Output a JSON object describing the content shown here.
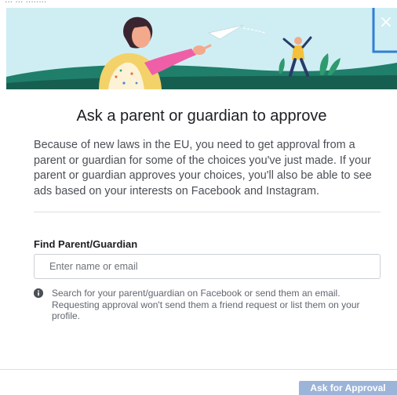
{
  "header": {
    "cut_off_text": "... ... ........"
  },
  "dialog": {
    "title": "Ask a parent or guardian to approve",
    "description": "Because of new laws in the EU, you need to get approval from a parent or guardian for some of the choices you've just made. If your parent or guardian approves your choices, you'll also be able to see ads based on your interests on Facebook and Instagram.",
    "field_label": "Find Parent/Guardian",
    "search": {
      "placeholder": "Enter name or email",
      "value": ""
    },
    "hint": "Search for your parent/guardian on Facebook or send them an email. Requesting approval won't send them a friend request or list them on your profile.",
    "submit_label": "Ask for Approval"
  },
  "icons": {
    "close": "close-icon",
    "info": "info-icon",
    "illustration": "paper-plane-illustration"
  },
  "colors": {
    "hero_sky": "#cfeef3",
    "hero_ground": "#1f7f6b",
    "accent_frame": "#2f7fd6",
    "button_disabled": "#9cb4d8",
    "divider": "#dddfe2"
  }
}
